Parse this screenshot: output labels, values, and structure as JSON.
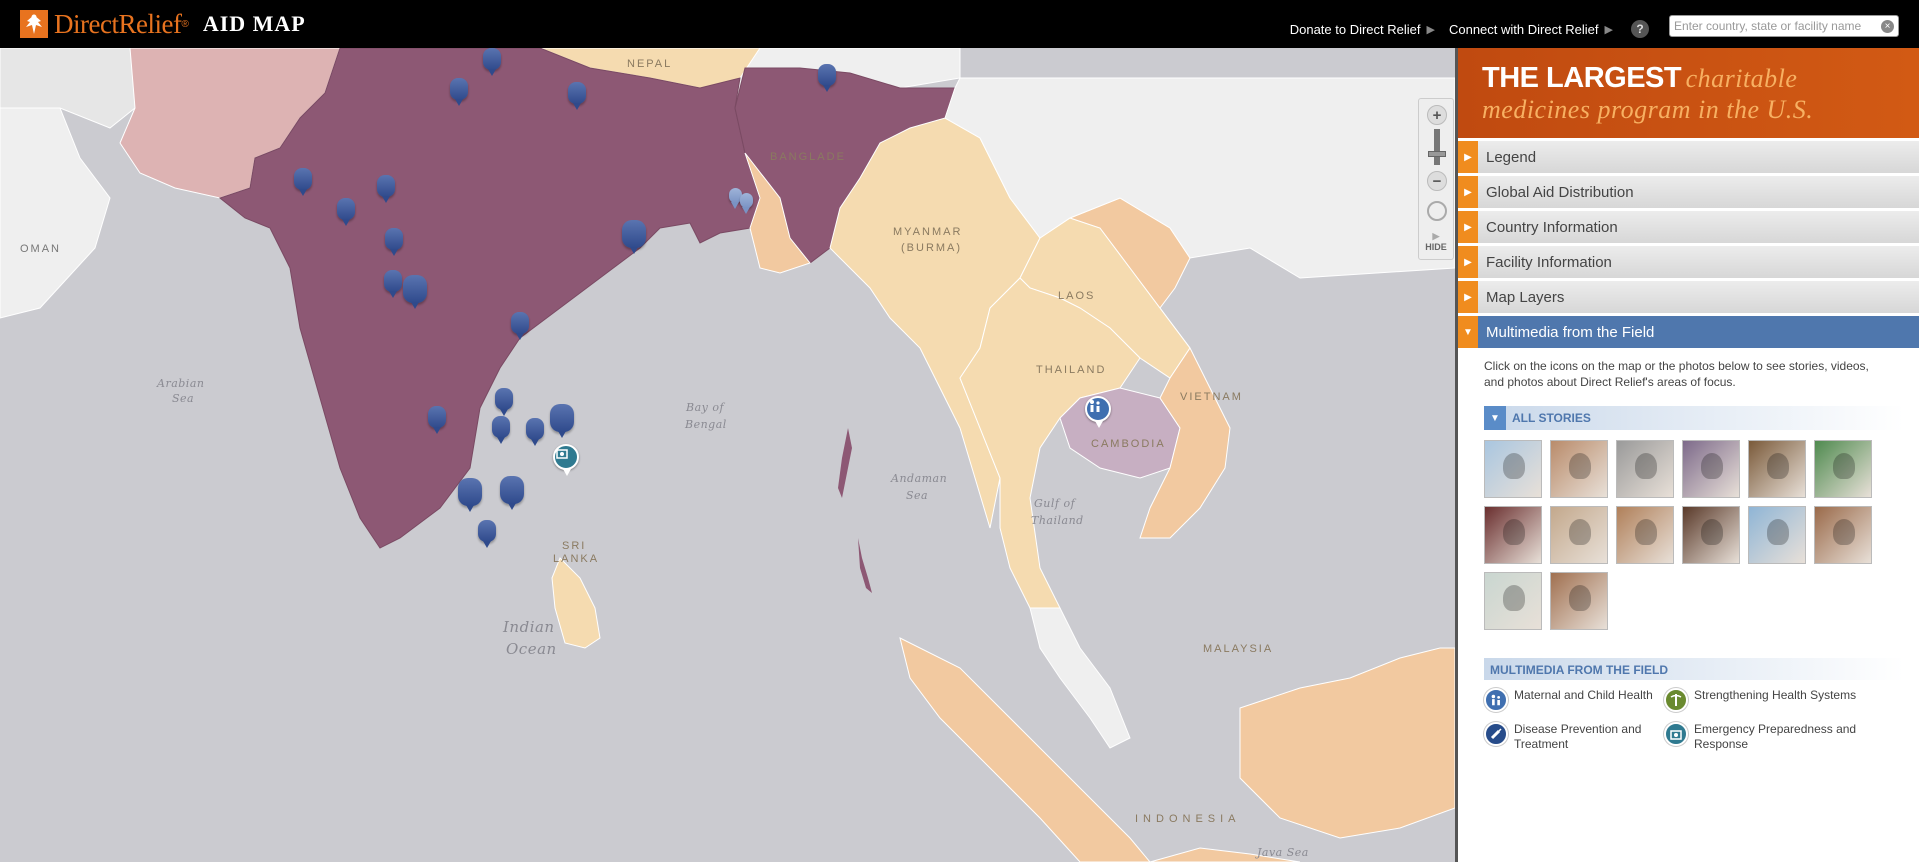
{
  "header": {
    "brand": "DirectRelief",
    "product": "AID MAP",
    "links": [
      {
        "label": "Donate to Direct Relief"
      },
      {
        "label": "Connect with Direct Relief"
      }
    ],
    "help_icon": "?",
    "search_placeholder": "Enter country, state or facility name"
  },
  "map": {
    "labels": {
      "oman": "OMAN",
      "nepal": "NEPAL",
      "bangladesh": "BANGLADE",
      "myanmar": "MYANMAR",
      "myanmar_paren": "(BURMA)",
      "laos": "LAOS",
      "thailand": "THAILAND",
      "cambodia": "CAMBODIA",
      "vietnam": "VIETNAM",
      "malaysia": "MALAYSIA",
      "indonesia": "INDONESIA",
      "sri": "SRI",
      "lanka": "LANKA",
      "arabian": "Arabian",
      "arabian_sea": "Sea",
      "bay": "Bay of",
      "bengal": "Bengal",
      "andaman": "Andaman",
      "andaman_sea": "Sea",
      "gulf": "Gulf of",
      "gulf_thailand": "Thailand",
      "indian": "Indian",
      "indian_ocean": "Ocean",
      "java": "Java Sea"
    },
    "colors": {
      "ocean": "#cbcbd0",
      "india": "#8d5874",
      "high": "#f2c9a0",
      "medium": "#f5dbb0",
      "light_pink": "#ddb3b3",
      "none": "#efefef"
    },
    "zoom": {
      "in": "+",
      "out": "−",
      "hide": "HIDE"
    }
  },
  "panel": {
    "banner_bold": "THE LARGEST",
    "banner_italic_1": "charitable",
    "banner_italic_2": "medicines program in the U.S.",
    "accordion": [
      {
        "label": "Legend",
        "expanded": false
      },
      {
        "label": "Global Aid Distribution",
        "expanded": false
      },
      {
        "label": "Country Information",
        "expanded": false
      },
      {
        "label": "Facility Information",
        "expanded": false
      },
      {
        "label": "Map Layers",
        "expanded": false
      },
      {
        "label": "Multimedia from the Field",
        "expanded": true
      }
    ],
    "description": "Click on the icons on the map or the photos below to see stories, videos, and photos about Direct Relief's areas of focus.",
    "all_stories": "ALL STORIES",
    "legend_title": "MULTIMEDIA FROM THE FIELD",
    "legend": [
      {
        "label": "Maternal and Child Health",
        "icon": "mother-child-icon",
        "color": "#3f6fb0"
      },
      {
        "label": "Strengthening Health Systems",
        "icon": "caduceus-icon",
        "color": "#6a8a2f"
      },
      {
        "label": "Disease Prevention and Treatment",
        "icon": "syringe-icon",
        "color": "#274c8a"
      },
      {
        "label": "Emergency Preparedness and Response",
        "icon": "medkit-icon",
        "color": "#2f7a90"
      }
    ],
    "thumbs": [
      {
        "subject": "map",
        "color": "#a9c6e0"
      },
      {
        "subject": "child-paper",
        "color": "#b98b6a"
      },
      {
        "subject": "portrait-bw",
        "color": "#9a9a9a"
      },
      {
        "subject": "crowd",
        "color": "#7d6a8a"
      },
      {
        "subject": "man-portrait",
        "color": "#7a5a3a"
      },
      {
        "subject": "truck",
        "color": "#4f8a4f"
      },
      {
        "subject": "child-red",
        "color": "#6a2f2f"
      },
      {
        "subject": "nurse",
        "color": "#c3a88c"
      },
      {
        "subject": "woman-scarf",
        "color": "#b0805a"
      },
      {
        "subject": "smiling-woman",
        "color": "#5a3a2a"
      },
      {
        "subject": "medical-staff",
        "color": "#8fb5d6"
      },
      {
        "subject": "building",
        "color": "#9a6a4a"
      },
      {
        "subject": "medicine-box",
        "color": "#c9d6d0"
      },
      {
        "subject": "group-photo",
        "color": "#a07050"
      }
    ]
  }
}
